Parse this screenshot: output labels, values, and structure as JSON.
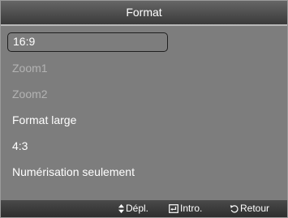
{
  "title": "Format",
  "items": [
    {
      "label": "16:9",
      "state": "selected"
    },
    {
      "label": "Zoom1",
      "state": "disabled"
    },
    {
      "label": "Zoom2",
      "state": "disabled"
    },
    {
      "label": "Format large",
      "state": "enabled"
    },
    {
      "label": "4:3",
      "state": "enabled"
    },
    {
      "label": "Numérisation seulement",
      "state": "enabled"
    }
  ],
  "footer": {
    "move_icon": "up-down-arrows-icon",
    "move_label": "Dépl.",
    "enter_icon": "enter-icon",
    "enter_label": "Intro.",
    "return_icon": "return-icon",
    "return_label": "Retour"
  },
  "colors": {
    "panel": "#7d7d7d",
    "title_bar": "#4f4f4f",
    "text": "#ffffff",
    "disabled_text": "#b3b3b3",
    "selection_border": "#1f1f1f"
  }
}
